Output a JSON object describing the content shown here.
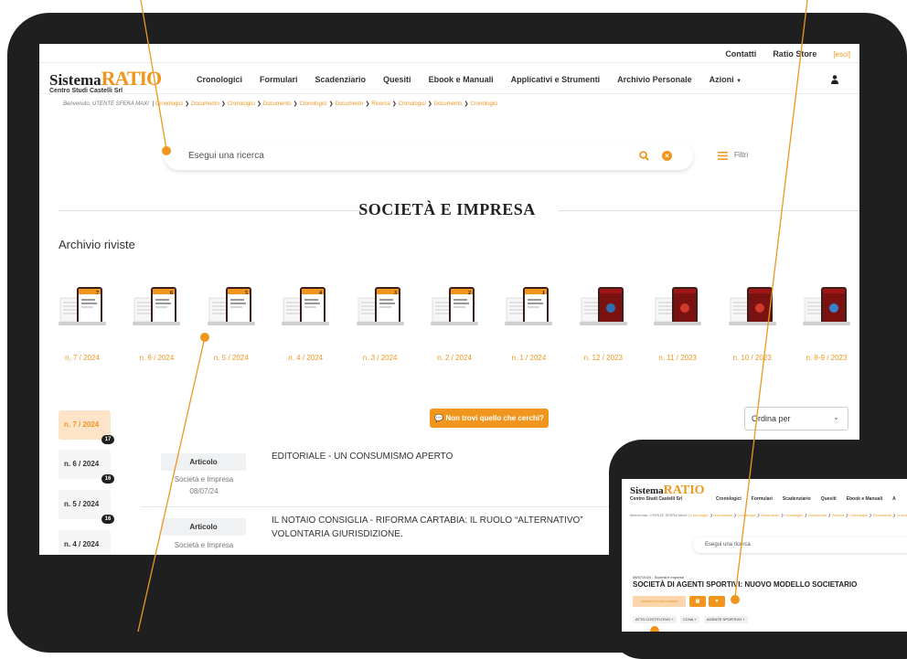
{
  "header": {
    "top_links": [
      "Contatti",
      "Ratio Store"
    ],
    "logout": "[esci]",
    "logo_main": "Sistema",
    "logo_ratio": "RATIO",
    "logo_sub": "Centro Studi Castelli Srl",
    "nav": [
      "Cronologici",
      "Formulari",
      "Scadenziario",
      "Quesiti",
      "Ebook e Manuali",
      "Applicativi e Strumenti",
      "Archivio Personale"
    ],
    "nav_last": "Azioni"
  },
  "breadcrumb": {
    "welcome": "Benvenuto, UTENTE SFERA MAXI",
    "items": [
      "Cronologici",
      "Documento",
      "Cronologici",
      "Documento",
      "Cronologici",
      "Documento",
      "Ricerca",
      "Cronologici",
      "Documento",
      "Cronologici"
    ]
  },
  "search": {
    "placeholder": "Esegui una ricerca",
    "filters_label": "Filtri"
  },
  "section": {
    "title": "SOCIETÀ E IMPRESA",
    "archive_title": "Archivio riviste"
  },
  "issues": [
    "n. 7 / 2024",
    "n. 6 / 2024",
    "n. 5 / 2024",
    "n. 4 / 2024",
    "n. 3 / 2024",
    "n. 2 / 2024",
    "n. 1 / 2024",
    "n. 12 / 2023",
    "n. 11 / 2023",
    "n. 10 / 2023",
    "n. 8-9 / 2023"
  ],
  "issue_cover_numbers": [
    "7",
    "6",
    "5",
    "4",
    "3",
    "2",
    "1"
  ],
  "chat_button": "Non trovi quello che cerchi?",
  "sort": {
    "label": "Ordina per"
  },
  "sidebar": [
    {
      "label": "n. 7 / 2024",
      "count": "17"
    },
    {
      "label": "n. 6 / 2024",
      "count": "16"
    },
    {
      "label": "n. 5 / 2024",
      "count": "16"
    },
    {
      "label": "n. 4 / 2024",
      "count": ""
    }
  ],
  "articles": [
    {
      "type": "Articolo",
      "source": "Società e Impresa",
      "date": "08/07/24",
      "title": "EDITORIALE - UN CONSUMISMO APERTO"
    },
    {
      "type": "Articolo",
      "source": "Società e Impresa",
      "date": "",
      "title": "IL NOTAIO CONSIGLIA - RIFORMA CARTABIA: IL RUOLO “ALTERNATIVO”",
      "title_line2": "VOLONTARIA GIURISDIZIONE."
    }
  ],
  "detail": {
    "logo_main": "Sistema",
    "logo_ratio": "RATIO",
    "logo_sub": "Centro Studi Castelli Srl",
    "nav": [
      "Cronologici",
      "Formulari",
      "Scadenziario",
      "Quesiti",
      "Ebook e Manuali",
      "A"
    ],
    "crumbs_welcome": "Benvenuto, UTENTE SFERA MAXI",
    "search_placeholder": "Esegui una ricerca",
    "meta": "08/07/2024 - Società e Impresa",
    "title": "SOCIETÀ DI AGENTI SPORTIVI: NUOVO MODELLO SOCIETARIO",
    "btn_primary": "Inserisci in una cartella",
    "tags": [
      "ATTO COSTITUTIVO +",
      "CCNA +",
      "AGENTE SPORTIVO +"
    ]
  },
  "colors": {
    "accent": "#f0961e",
    "device": "#1f1f1f",
    "accent_light": "#fde4c8"
  }
}
